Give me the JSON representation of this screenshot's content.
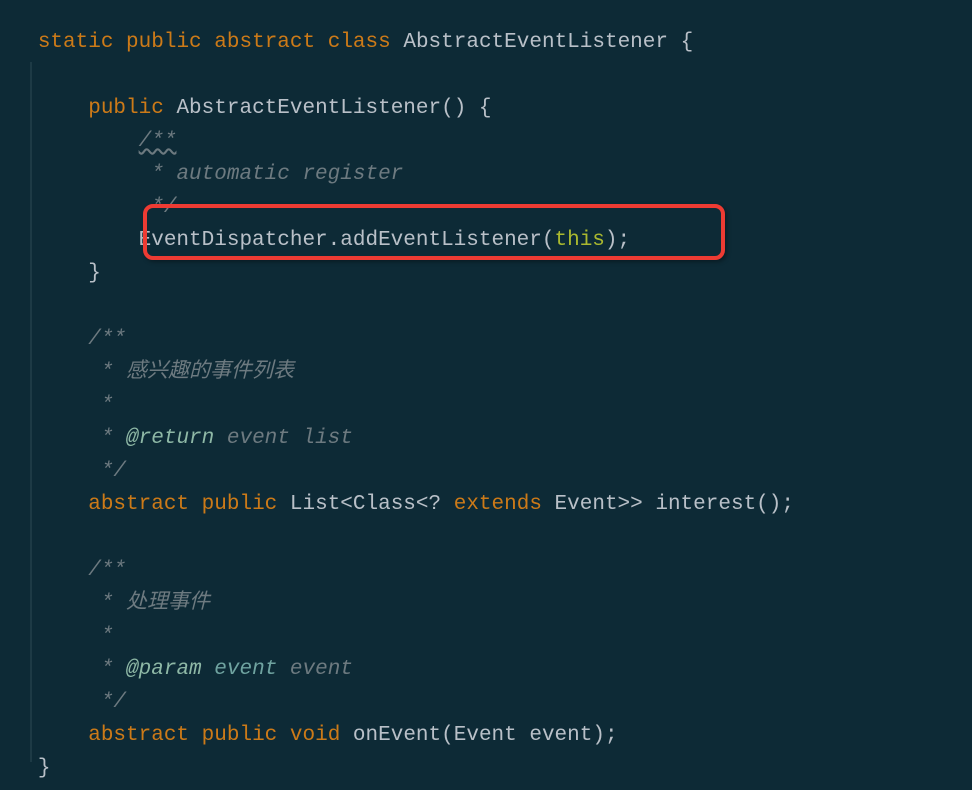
{
  "code": {
    "l01": {
      "p": "   ",
      "k1": "static",
      "s1": " ",
      "k2": "public",
      "s2": " ",
      "k3": "abstract",
      "s3": " ",
      "k4": "class",
      "s4": " ",
      "name": "AbstractEventListener",
      "tail": " {"
    },
    "l03": {
      "p": "       ",
      "k1": "public",
      "s1": " ",
      "name": "AbstractEventListener",
      "tail": "() {"
    },
    "l04": {
      "p": "           ",
      "t": "/**"
    },
    "l05": {
      "p": "            ",
      "t": "* automatic register"
    },
    "l06": {
      "p": "            ",
      "t": "*/"
    },
    "l07": {
      "p": "           ",
      "a": "EventDispatcher",
      "b": ".addEventListener(",
      "c": "this",
      "d": ");"
    },
    "l08": {
      "p": "       ",
      "t": "}"
    },
    "l10": {
      "p": "       ",
      "t": "/**"
    },
    "l11": {
      "p": "        ",
      "t": "* 感兴趣的事件列表"
    },
    "l12": {
      "p": "        ",
      "t": "*"
    },
    "l13": {
      "p": "        ",
      "a": "* ",
      "b": "@return",
      "c": " event list"
    },
    "l14": {
      "p": "        ",
      "t": "*/"
    },
    "l15": {
      "p": "       ",
      "k1": "abstract",
      "s1": " ",
      "k2": "public",
      "s2": " ",
      "a": "List<Class<? ",
      "k3": "extends",
      "b": " Event>> interest();"
    },
    "l17": {
      "p": "       ",
      "t": "/**"
    },
    "l18": {
      "p": "        ",
      "t": "* 处理事件"
    },
    "l19": {
      "p": "        ",
      "t": "*"
    },
    "l20": {
      "p": "        ",
      "a": "* ",
      "b": "@param",
      "c": " ",
      "d": "event",
      "e": " event"
    },
    "l21": {
      "p": "        ",
      "t": "*/"
    },
    "l22": {
      "p": "       ",
      "k1": "abstract",
      "s1": " ",
      "k2": "public",
      "s2": " ",
      "k3": "void",
      "s3": " ",
      "a": "onEvent(Event event);"
    },
    "l23": {
      "p": "   ",
      "t": "}"
    }
  }
}
